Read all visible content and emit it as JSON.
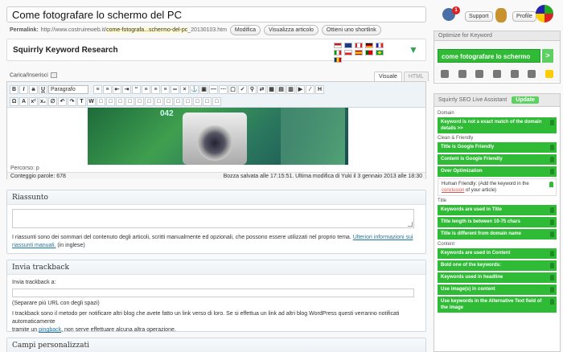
{
  "post": {
    "title": "Come fotografare lo schermo del PC",
    "permalink_label": "Permalink:",
    "permalink_base": "http://www.costruireweb.it/",
    "permalink_slug": "come-fotografa...schermo-del-pc",
    "permalink_suffix": "_20130103.htm",
    "buttons": [
      "Modifica",
      "Visualizza articolo",
      "Ottieni uno shortlink"
    ]
  },
  "squirrly_box": {
    "title": "Squirrly Keyword Research"
  },
  "editor": {
    "upload_label": "Carica/Inserisci",
    "tabs": [
      "Visuale",
      "HTML"
    ],
    "format_select": "Paragrafo",
    "image_number": "042",
    "path": "Percorso: p",
    "word_count": "Conteggio parole: 678",
    "saved_status": "Bozza salvata alle 17:15:51. Ultima modifica di Yuki il 3 gennaio 2013 alle 18:30"
  },
  "excerpt": {
    "title": "Riassunto",
    "text": "I riassunti sono dei sommari del contenuto degli articoli, scritti manualmente ed opzionali, che possono essere utilizzati nel proprio tema.",
    "link": "Ulteriori informazioni sui riassunti manuali.",
    "suffix": "(in inglese)"
  },
  "trackback": {
    "title": "Invia trackback",
    "label": "Invia trackback a:",
    "hint": "(Separare più URL con degli spazi)",
    "text1": "I trackback sono il metodo per notificare altri blog che avete fatto un link verso di loro. Se si effettua un link ad altri blog WordPress questi verranno notificati automaticamente",
    "text2_a": "tramite un",
    "link": "pingback",
    "text2_b": ", non serve effettuare alcuna altra operazione."
  },
  "custom_fields": {
    "title": "Campi personalizzati"
  },
  "topbar": {
    "badge": "1",
    "support": "Support",
    "profile": "Profile"
  },
  "optimize": {
    "title": "Optimize for Keyword",
    "keyword": "come fotografare lo schermo",
    "go": ">"
  },
  "live_assistant": {
    "title": "Squirrly SEO Live Assistant",
    "update": "Update",
    "sections": [
      {
        "name": "Domain",
        "items": [
          {
            "text": "Keyword is not a exact match of the domain details >>",
            "white": false
          }
        ]
      },
      {
        "name": "Clean & Friendly",
        "items": [
          {
            "text": "Title is Google Friendly",
            "white": false
          },
          {
            "text": "Content is Google Friendly",
            "white": false
          },
          {
            "text": "Over Optimization",
            "white": false
          },
          {
            "text": "Human Friendly: (Add the keyword in the",
            "link": "conclusion",
            "tail": "of your article)",
            "white": true
          }
        ]
      },
      {
        "name": "Title",
        "items": [
          {
            "text": "Keywords are used in Title",
            "white": false
          },
          {
            "text": "Title length is between 10-75 chars",
            "white": false
          },
          {
            "text": "Title is different from domain name",
            "white": false
          }
        ]
      },
      {
        "name": "Content",
        "items": [
          {
            "text": "Keywords are used in Content",
            "white": false
          },
          {
            "text": "Bold one of the keywords:",
            "white": false
          },
          {
            "text": "Keywords used in headline",
            "white": false
          },
          {
            "text": "Use image(s) in content",
            "white": false
          },
          {
            "text": "Use keywords in the Alternative Text field of the image",
            "white": false
          }
        ]
      }
    ]
  }
}
